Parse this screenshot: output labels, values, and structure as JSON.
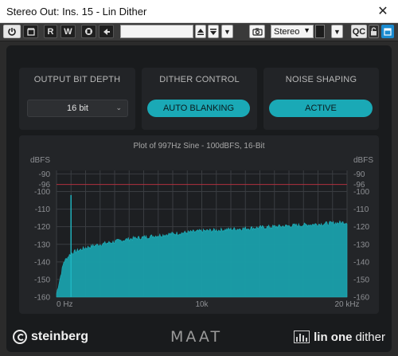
{
  "window": {
    "title": "Stereo Out: Ins. 15 - Lin Dither",
    "close_glyph": "✕"
  },
  "toolbar": {
    "read_label": "R",
    "write_label": "W",
    "routing_select": "Stereo",
    "qc_label": "QC"
  },
  "panels": {
    "bit_depth": {
      "title": "OUTPUT BIT DEPTH",
      "value": "16 bit"
    },
    "dither": {
      "title": "DITHER CONTROL",
      "button": "AUTO BLANKING"
    },
    "noise": {
      "title": "NOISE SHAPING",
      "button": "ACTIVE"
    }
  },
  "plot": {
    "title": "Plot of 997Hz Sine - 100dBFS, 16-Bit"
  },
  "chart_data": {
    "type": "area",
    "title": "Plot of 997Hz Sine - 100dBFS, 16-Bit",
    "y_unit": "dBFS",
    "ylim": [
      -160,
      -88
    ],
    "y_ticks": [
      -90,
      -96,
      -100,
      -110,
      -120,
      -130,
      -140,
      -150,
      -160
    ],
    "x_tick_labels": [
      "0 Hz",
      "10k",
      "20 kHz"
    ],
    "xlim": [
      0,
      20000
    ],
    "reference_line_dbfs": -96,
    "peak": {
      "x": 997,
      "y": -102
    },
    "series": [
      {
        "x": [
          0,
          500,
          1000,
          2000,
          3000,
          4000,
          5000,
          6000,
          8000,
          10000,
          12000,
          14000,
          16000,
          18000,
          20000
        ],
        "y": [
          -158,
          -140,
          -135,
          -132,
          -130,
          -128.5,
          -127,
          -126,
          -124,
          -122.5,
          -121.5,
          -120.5,
          -119.5,
          -118.5,
          -117.5
        ]
      }
    ],
    "colors": {
      "fill": "#1aa0ab",
      "line": "#1fb8c4",
      "reference": "#b0313f",
      "grid": "#3a3d41"
    }
  },
  "footer": {
    "brand_left": "steinberg",
    "brand_center": "MAAT",
    "brand_right_bold": "lin one",
    "brand_right_light": "dither"
  }
}
